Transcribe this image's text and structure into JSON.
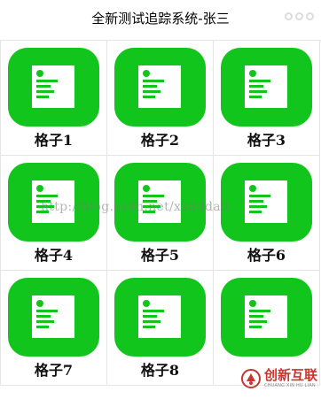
{
  "header": {
    "title": "全新测试追踪系统-张三"
  },
  "grid": {
    "items": [
      {
        "label": "格子1"
      },
      {
        "label": "格子2"
      },
      {
        "label": "格子3"
      },
      {
        "label": "格子4"
      },
      {
        "label": "格子5"
      },
      {
        "label": "格子6"
      },
      {
        "label": "格子7"
      },
      {
        "label": "格子8"
      },
      {
        "label": ""
      }
    ]
  },
  "watermark": {
    "url": "http://blog.csdn.net/xxdddail"
  },
  "brand": {
    "name_cn": "创新互联",
    "name_en": "CHUANG XIN HU LIAN"
  },
  "colors": {
    "accent": "#12c51d",
    "brand_red": "#c8362e"
  }
}
